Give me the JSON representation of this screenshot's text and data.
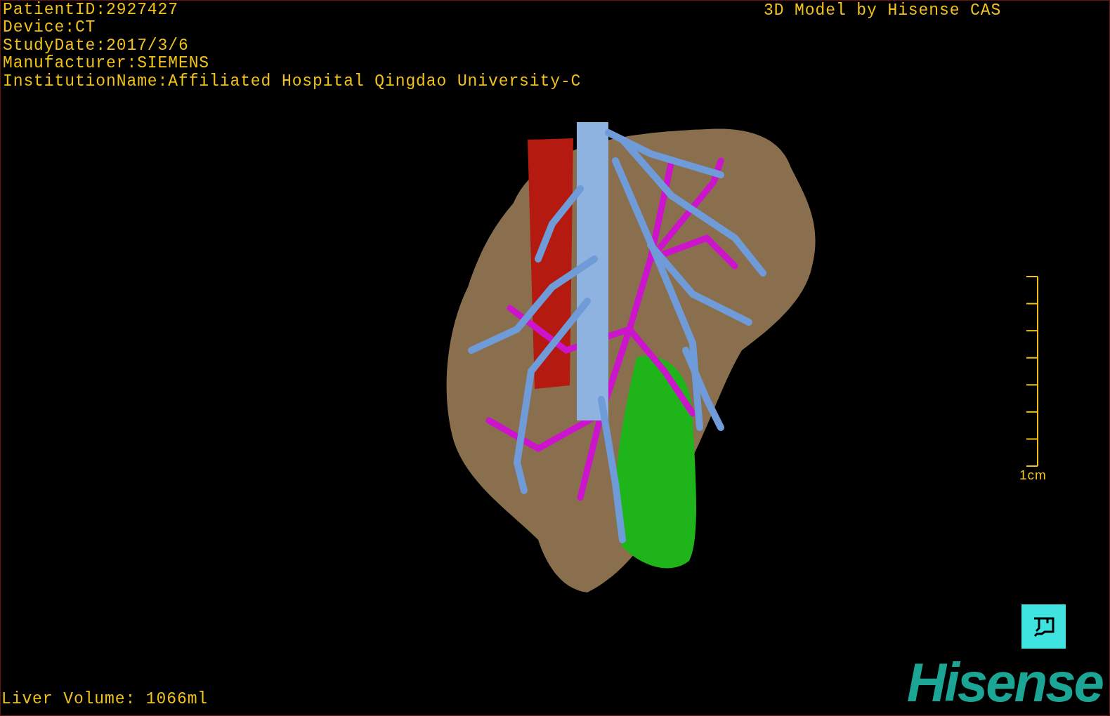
{
  "study_info": [
    "PatientID:2927427",
    "Device:CT",
    "StudyDate:2017/3/6",
    "Manufacturer:SIEMENS",
    "InstitutionName:Affiliated Hospital Qingdao University-C"
  ],
  "header_label": "3D Model by Hisense CAS",
  "scale_bar": {
    "label": "1cm"
  },
  "liver_volume": "Liver Volume: 1066ml",
  "logo": "Hisense"
}
